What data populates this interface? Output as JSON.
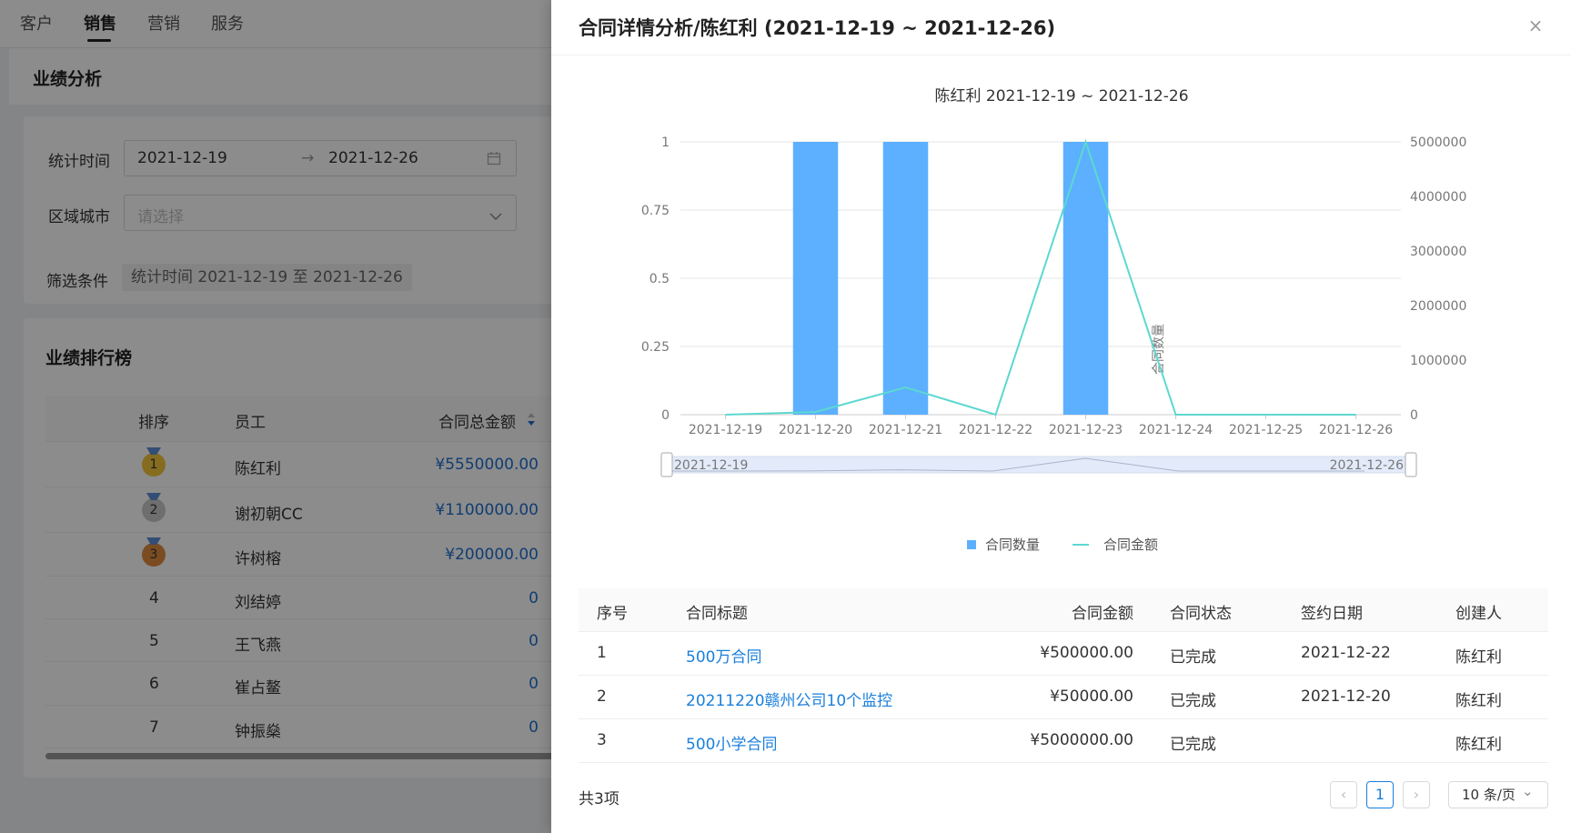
{
  "topnav": {
    "items": [
      "客户",
      "销售",
      "营销",
      "服务"
    ],
    "active": "销售"
  },
  "page": {
    "section_title": "业绩分析"
  },
  "filters": {
    "time_label": "统计时间",
    "start_date": "2021-12-19",
    "end_date": "2021-12-26",
    "range_arrow": "→",
    "city_label": "区域城市",
    "city_placeholder": "请选择",
    "condition_label": "筛选条件",
    "condition_tag": "统计时间 2021-12-19 至 2021-12-26"
  },
  "ranking": {
    "title": "业绩排行榜",
    "headers": {
      "rank": "排序",
      "employee": "员工",
      "amount": "合同总金额"
    },
    "rows": [
      {
        "rank": "1",
        "name": "陈红利",
        "amount": "¥5550000.00",
        "medal_color": "#f2c53a"
      },
      {
        "rank": "2",
        "name": "谢初朝CC",
        "amount": "¥1100000.00",
        "medal_color": "#c9c9c9"
      },
      {
        "rank": "3",
        "name": "许树榕",
        "amount": "¥200000.00",
        "medal_color": "#e08a3c"
      },
      {
        "rank": "4",
        "name": "刘结婷",
        "amount": "0"
      },
      {
        "rank": "5",
        "name": "王飞燕",
        "amount": "0"
      },
      {
        "rank": "6",
        "name": "崔占鳌",
        "amount": "0"
      },
      {
        "rank": "7",
        "name": "钟振燊",
        "amount": "0"
      }
    ]
  },
  "drawer": {
    "title": "合同详情分析/陈红利 (2021-12-19 ~ 2021-12-26)",
    "close_icon": "×",
    "table": {
      "headers": {
        "index": "序号",
        "title": "合同标题",
        "amount": "合同金额",
        "status": "合同状态",
        "date": "签约日期",
        "creator": "创建人"
      },
      "rows": [
        {
          "index": "1",
          "title": "500万合同",
          "amount": "¥500000.00",
          "status": "已完成",
          "date": "2021-12-22",
          "creator": "陈红利"
        },
        {
          "index": "2",
          "title": "20211220赣州公司10个监控",
          "amount": "¥50000.00",
          "status": "已完成",
          "date": "2021-12-20",
          "creator": "陈红利"
        },
        {
          "index": "3",
          "title": "500小学合同",
          "amount": "¥5000000.00",
          "status": "已完成",
          "date": "",
          "creator": "陈红利"
        }
      ]
    },
    "pagination": {
      "total": "共3项",
      "prev_icon": "‹",
      "current_page": "1",
      "next_icon": "›",
      "page_size": "10 条/页",
      "page_size_icon": "⌄"
    }
  },
  "chart_data": {
    "type": "bar",
    "title": "陈红利 2021-12-19  ~  2021-12-26",
    "categories": [
      "2021-12-19",
      "2021-12-20",
      "2021-12-21",
      "2021-12-22",
      "2021-12-23",
      "2021-12-24",
      "2021-12-25",
      "2021-12-26"
    ],
    "series": [
      {
        "name": "合同数量",
        "kind": "bar",
        "axis": "left",
        "color": "#5cb0ff",
        "values": [
          0,
          1,
          1,
          0,
          1,
          0,
          0,
          0
        ]
      },
      {
        "name": "合同金额",
        "kind": "line",
        "axis": "right",
        "color": "#5dd8d0",
        "values": [
          0,
          50000,
          500000,
          0,
          5000000,
          0,
          0,
          0
        ]
      }
    ],
    "y_left": {
      "label": "合同数量",
      "ylim": [
        0,
        1
      ],
      "ticks": [
        "0",
        "0.25",
        "0.5",
        "0.75",
        "1"
      ]
    },
    "y_right": {
      "label": "合同金额",
      "ylim": [
        0,
        5000000
      ],
      "ticks": [
        "0",
        "1000000",
        "2000000",
        "3000000",
        "4000000",
        "5000000"
      ]
    },
    "zoom": {
      "start_label": "2021-12-19",
      "end_label": "2021-12-26"
    },
    "legend": {
      "position": "bottom"
    },
    "grid": true
  }
}
